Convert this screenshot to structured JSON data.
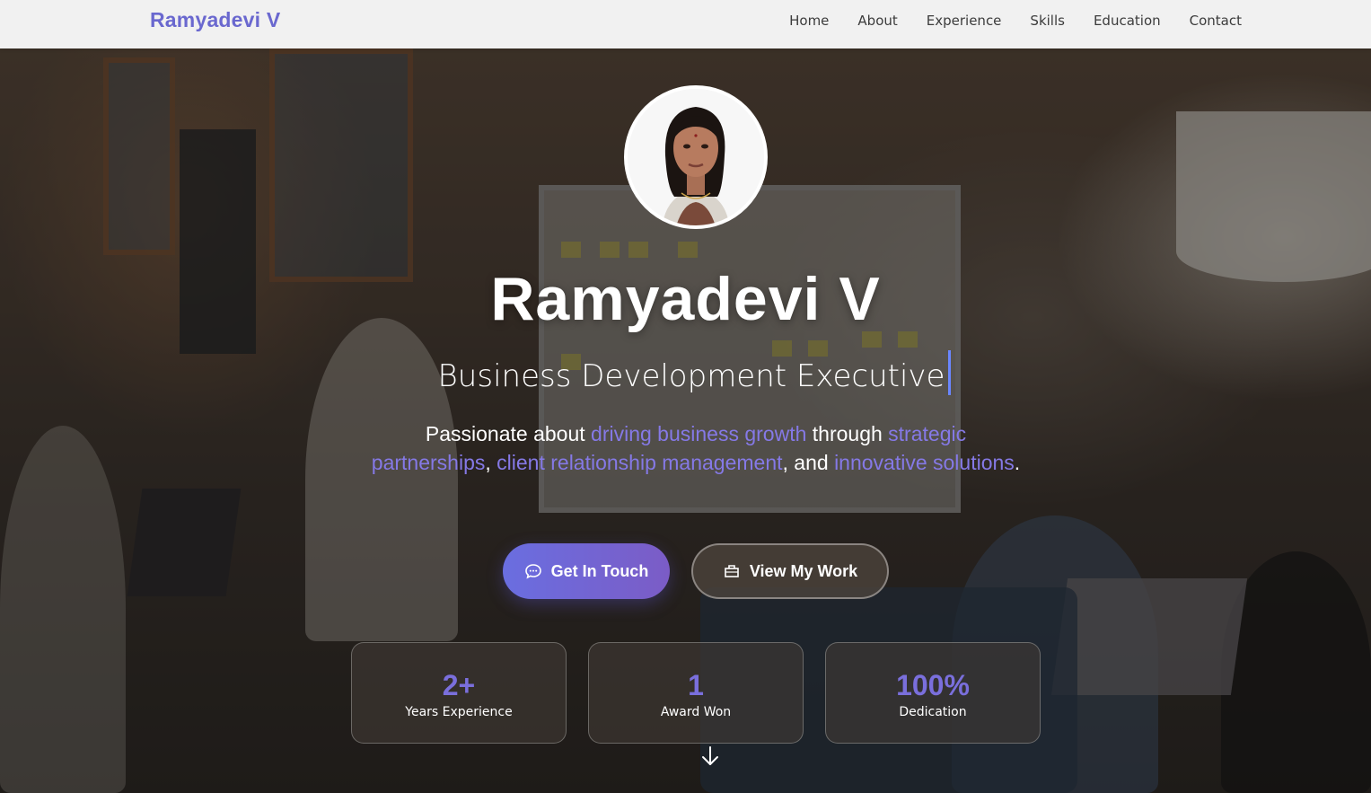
{
  "nav": {
    "brand": "Ramyadevi V",
    "links": [
      "Home",
      "About",
      "Experience",
      "Skills",
      "Education",
      "Contact"
    ]
  },
  "hero": {
    "name": "Ramyadevi V",
    "role": "Business Development Executive",
    "tagline": {
      "t1": "Passionate about ",
      "h1": "driving business growth",
      "t2": " through ",
      "h2": "strategic partnerships",
      "t3": ", ",
      "h3": "client relationship management",
      "t4": ", and ",
      "h4": "innovative solutions",
      "t5": "."
    },
    "buttons": {
      "primary": "Get In Touch",
      "secondary": "View My Work"
    },
    "stats": [
      {
        "value": "2+",
        "label": "Years Experience"
      },
      {
        "value": "1",
        "label": "Award Won"
      },
      {
        "value": "100%",
        "label": "Dedication"
      }
    ],
    "icons": {
      "primary_button": "chat-bubble-icon",
      "secondary_button": "briefcase-icon",
      "scroll": "arrow-down-icon"
    }
  },
  "colors": {
    "accent": "#6a68cf",
    "highlight": "#8579e6",
    "stat_value": "#7a6fdc",
    "nav_bg": "#f1f1f1"
  }
}
